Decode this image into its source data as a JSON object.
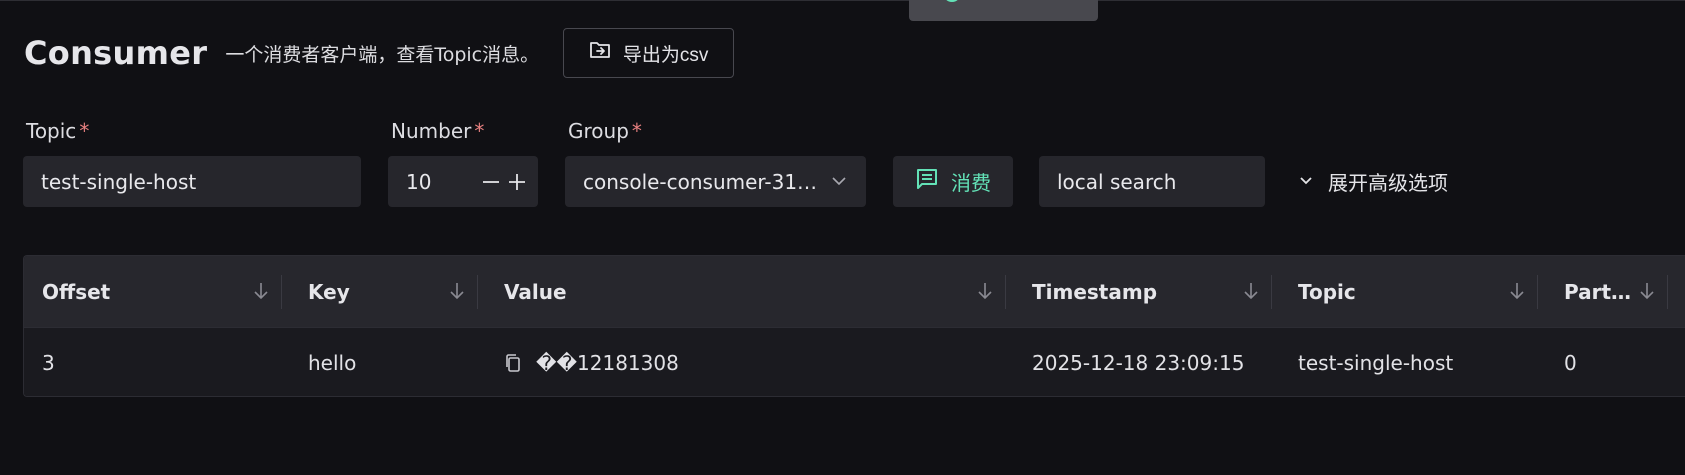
{
  "page": {
    "title": "Consumer",
    "subtitle": "一个消费者客户端，查看Topic消息。",
    "export_label": "导出为csv"
  },
  "form": {
    "topic_label": "Topic",
    "topic_value": "test-single-host",
    "number_label": "Number",
    "number_value": "10",
    "group_label": "Group",
    "group_value": "console-consumer-31…",
    "required_mark": "*",
    "consume_label": "消费",
    "search_placeholder": "local search",
    "advanced_label": "展开高级选项"
  },
  "table": {
    "columns": [
      "Offset",
      "Key",
      "Value",
      "Timestamp",
      "Topic",
      "Part…"
    ],
    "rows": [
      {
        "offset": "3",
        "key": "hello",
        "value": "��12181308",
        "timestamp": "2025-12-18 23:09:15",
        "topic": "test-single-host",
        "partition": "0"
      }
    ]
  },
  "colors": {
    "accent": "#63e2b7",
    "required": "#e88080",
    "background": "#101014"
  },
  "icons": {
    "export": "export-file-icon",
    "consume": "message-icon",
    "advanced": "chevron-down-icon",
    "sort": "sort-arrow-icon",
    "copy": "copy-icon"
  }
}
